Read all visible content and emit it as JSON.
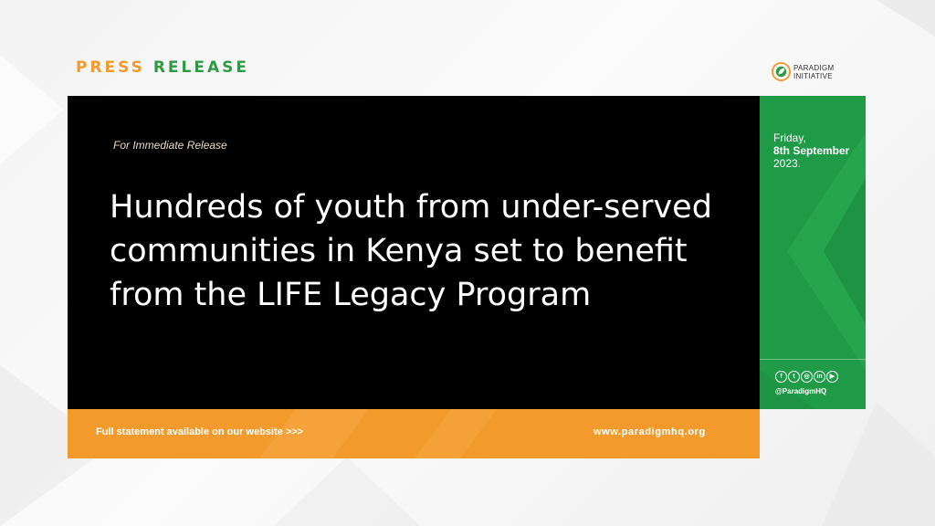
{
  "header": {
    "title_word1": "PRESS",
    "title_word2": "RELEASE",
    "logo_line1": "Paradigm",
    "logo_line2": "Initiative"
  },
  "main": {
    "tagline": "For Immediate Release",
    "headline": "Hundreds of youth from under-served communities in Kenya set to benefit from the LIFE Legacy Program"
  },
  "sidebar": {
    "day": "Friday,",
    "date": "8th September",
    "year": "2023.",
    "social_icons": [
      "facebook-icon",
      "twitter-icon",
      "instagram-icon",
      "linkedin-icon",
      "youtube-icon"
    ],
    "handle": "@ParadigmHQ"
  },
  "footer": {
    "statement": "Full statement available on our website >>>",
    "website": "www.paradigmhq.org"
  },
  "colors": {
    "orange": "#f39a2c",
    "green": "#1f9a47",
    "black": "#000000"
  }
}
